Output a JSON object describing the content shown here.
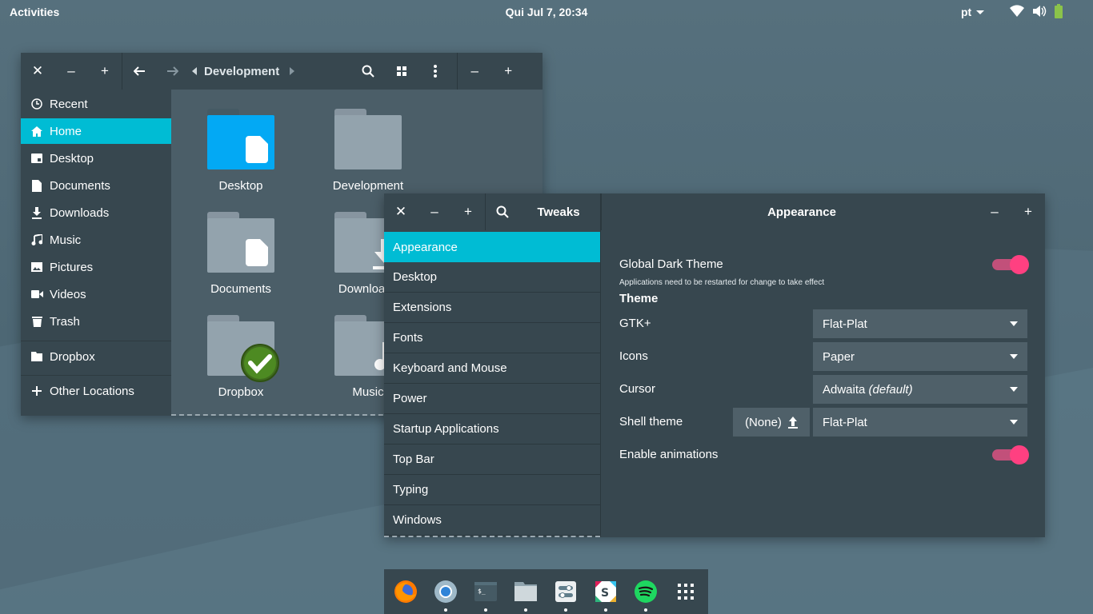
{
  "topbar": {
    "activities": "Activities",
    "clock": "Qui Jul  7, 20:34",
    "lang": "pt"
  },
  "files": {
    "breadcrumb": "Development",
    "sidebar": [
      {
        "label": "Recent",
        "icon": "clock-icon"
      },
      {
        "label": "Home",
        "icon": "home-icon",
        "selected": true
      },
      {
        "label": "Desktop",
        "icon": "desktop-icon"
      },
      {
        "label": "Documents",
        "icon": "document-icon"
      },
      {
        "label": "Downloads",
        "icon": "download-icon"
      },
      {
        "label": "Music",
        "icon": "music-icon"
      },
      {
        "label": "Pictures",
        "icon": "picture-icon"
      },
      {
        "label": "Videos",
        "icon": "video-icon"
      },
      {
        "label": "Trash",
        "icon": "trash-icon"
      },
      {
        "label": "Dropbox",
        "icon": "folder-icon"
      },
      {
        "label": "Other Locations",
        "icon": "plus-icon"
      }
    ],
    "items": [
      {
        "label": "Desktop"
      },
      {
        "label": "Development"
      },
      {
        "label": "Documents"
      },
      {
        "label": "Downloads"
      },
      {
        "label": "Dropbox"
      },
      {
        "label": "Music"
      }
    ]
  },
  "tweaks": {
    "app_title": "Tweaks",
    "page_title": "Appearance",
    "categories": [
      "Appearance",
      "Desktop",
      "Extensions",
      "Fonts",
      "Keyboard and Mouse",
      "Power",
      "Startup Applications",
      "Top Bar",
      "Typing",
      "Windows"
    ],
    "global_dark_label": "Global Dark Theme",
    "global_dark_note": "Applications need to be restarted for change to take effect",
    "global_dark_on": true,
    "theme_heading": "Theme",
    "gtk_label": "GTK+",
    "gtk_value": "Flat-Plat",
    "icons_label": "Icons",
    "icons_value": "Paper",
    "cursor_label": "Cursor",
    "cursor_value": "Adwaita",
    "cursor_default": "(default)",
    "shell_label": "Shell theme",
    "shell_none": "(None)",
    "shell_value": "Flat-Plat",
    "animations_label": "Enable animations",
    "animations_on": true
  },
  "dock": {
    "apps": [
      "firefox-icon",
      "chromium-icon",
      "terminal-icon",
      "files-icon",
      "tweaks-icon",
      "slack-icon",
      "spotify-icon",
      "app-grid-icon"
    ]
  },
  "colors": {
    "accent": "#00bcd4",
    "toggle": "#ff4081",
    "header": "#37474f"
  }
}
